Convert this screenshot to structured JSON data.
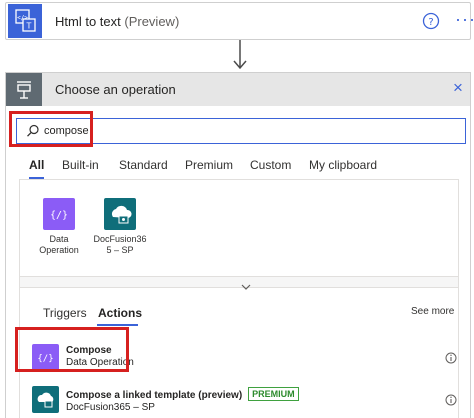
{
  "top_card": {
    "title": "Html to text",
    "title_suffix": "(Preview)",
    "icon": "html-code-icon",
    "help_icon": "help-circle-icon",
    "more_label": "···",
    "accent": "#3b63d8"
  },
  "operation_panel": {
    "title": "Choose an operation",
    "close_label": "×",
    "header_bg": "#e6e6e6",
    "icon_bg": "#5f6a72"
  },
  "search": {
    "value": "compose",
    "icon": "search-icon"
  },
  "tabs": [
    {
      "label": "All",
      "active": true
    },
    {
      "label": "Built-in",
      "active": false
    },
    {
      "label": "Standard",
      "active": false
    },
    {
      "label": "Premium",
      "active": false
    },
    {
      "label": "Custom",
      "active": false
    },
    {
      "label": "My clipboard",
      "active": false
    }
  ],
  "connectors": [
    {
      "label_line1": "Data",
      "label_line2": "Operation",
      "icon": "data-operation-icon",
      "color": "#8b5cf6"
    },
    {
      "label_line1": "DocFusion36",
      "label_line2": "5 – SP",
      "icon": "docfusion-cloud-icon",
      "color": "#0f6e7a"
    }
  ],
  "sub_tabs": [
    {
      "label": "Triggers",
      "active": false
    },
    {
      "label": "Actions",
      "active": true
    }
  ],
  "see_more": "See more",
  "actions": [
    {
      "title": "Compose",
      "subtitle": "Data Operation",
      "icon": "data-operation-icon",
      "color": "#8b5cf6",
      "badge": ""
    },
    {
      "title": "Compose a linked template (preview)",
      "subtitle": "DocFusion365 – SP",
      "icon": "docfusion-cloud-icon",
      "color": "#0f6e7a",
      "badge": "PREMIUM"
    }
  ],
  "highlight_color": "#d6201f"
}
